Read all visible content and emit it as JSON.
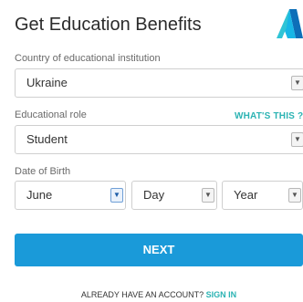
{
  "header": {
    "title": "Get Education Benefits",
    "logo_icon": "autodesk-logo-icon",
    "logo_colors": [
      "#0d6fb8",
      "#17b6e6",
      "#2fc4d6"
    ]
  },
  "country": {
    "label": "Country of educational institution",
    "value": "Ukraine"
  },
  "role": {
    "label": "Educational role",
    "help_link": "WHAT'S THIS ?",
    "value": "Student"
  },
  "dob": {
    "label": "Date of Birth",
    "month": "June",
    "day": "Day",
    "year": "Year"
  },
  "actions": {
    "next_label": "NEXT",
    "account_prompt": "ALREADY HAVE AN ACCOUNT?",
    "signin_label": "SIGN IN"
  },
  "colors": {
    "primary_button": "#1a9ad9",
    "link": "#2bb3b3"
  }
}
